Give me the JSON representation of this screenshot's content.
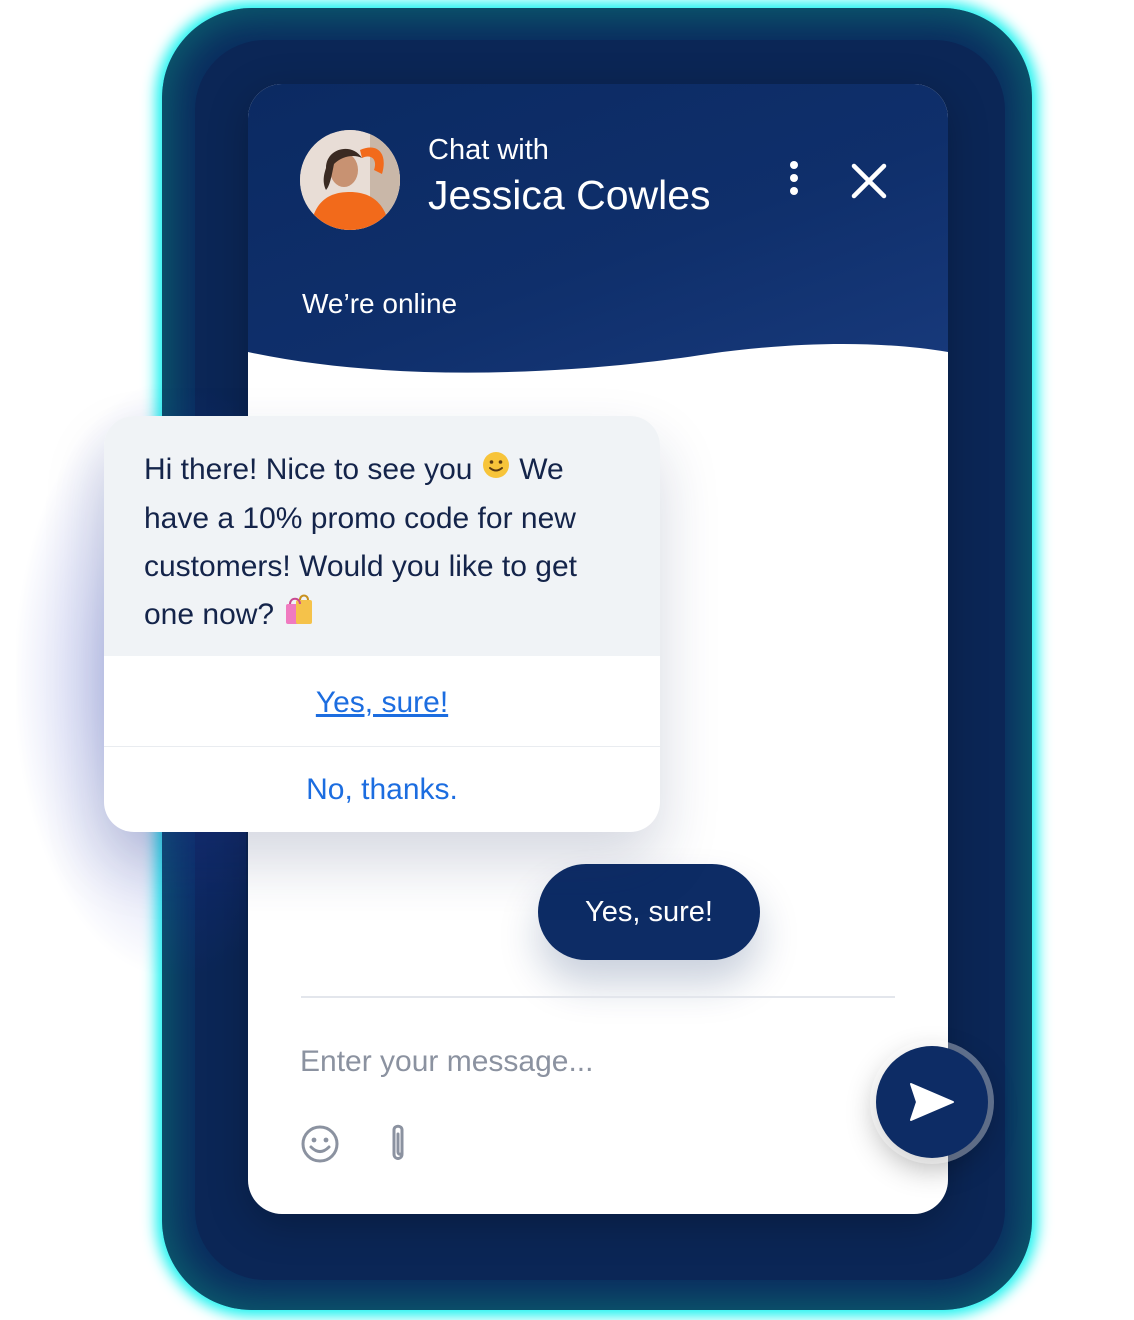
{
  "header": {
    "subtitle": "Chat with",
    "agent_name": "Jessica Cowles",
    "status": "We’re online",
    "menu_icon": "more-vertical-icon",
    "close_icon": "close-icon"
  },
  "popup": {
    "message_line1": "Hi there! Nice to see you",
    "message_line1b": "We",
    "message_rest": "have a 10% promo code for new customers! Would you like to get one now?",
    "options": [
      "Yes, sure!",
      "No, thanks."
    ]
  },
  "conversation": {
    "visitor_message": "Yes, sure!"
  },
  "composer": {
    "placeholder": "Enter your message...",
    "emoji_icon": "smiley-icon",
    "attach_icon": "paperclip-icon",
    "send_icon": "send-icon"
  },
  "colors": {
    "brand_navy": "#0d2c65",
    "link_blue": "#1c6de0",
    "glow_cyan": "#19f3f0"
  }
}
